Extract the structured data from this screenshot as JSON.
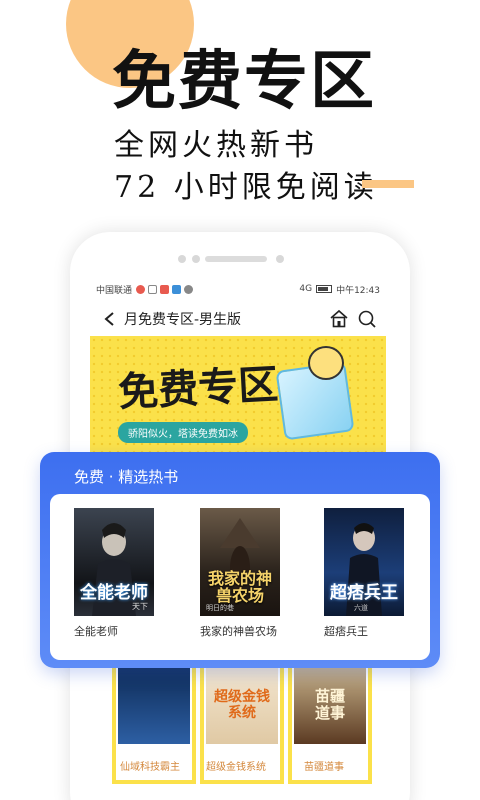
{
  "hero": {
    "title": "免费专区",
    "subtitle_line1": "全网火热新书",
    "subtitle_line2": "72 小时限免阅读"
  },
  "status_bar": {
    "carrier": "中国联通",
    "time": "中午12:43",
    "signal": "4G"
  },
  "nav": {
    "title": "月免费专区-男生版"
  },
  "banner": {
    "title": "免费专区",
    "slogan": "骄阳似火，塔读免费如冰"
  },
  "featured": {
    "section_title": "免费 · 精选热书",
    "books": [
      {
        "title": "全能老师",
        "cover_text": "全能老师",
        "cover_sub": "天下"
      },
      {
        "title": "我家的神兽农场",
        "cover_text": "我家的神兽农场",
        "cover_sub": "明日的巷"
      },
      {
        "title": "超痞兵王",
        "cover_text": "超痞兵王",
        "cover_sub": "六道"
      }
    ]
  },
  "more_books": [
    {
      "title": "仙域科技霸主"
    },
    {
      "title": "超级金钱系统",
      "cover_text": "超级金钱系统"
    },
    {
      "title": "苗疆道事",
      "cover_text": "苗疆道事"
    }
  ],
  "colors": {
    "accent_orange": "#fbc684",
    "card_blue": "#4a7af2",
    "banner_yellow": "#fbe14a",
    "lower_title": "#d4883c"
  }
}
